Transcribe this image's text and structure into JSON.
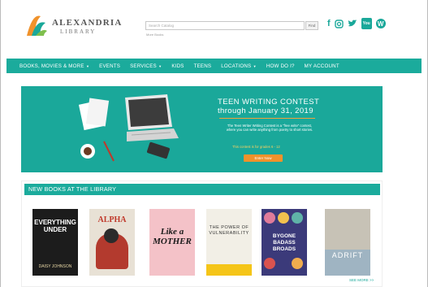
{
  "header": {
    "logo_name": "ALEXANDRIA",
    "logo_sub": "LIBRARY",
    "search_placeholder": "Search Catalog",
    "find_label": "Find",
    "sub_link": "More Books"
  },
  "nav": {
    "items": [
      {
        "label": "BOOKS, MOVIES & MORE",
        "dropdown": true
      },
      {
        "label": "EVENTS",
        "dropdown": false
      },
      {
        "label": "SERVICES",
        "dropdown": true
      },
      {
        "label": "KIDS",
        "dropdown": false
      },
      {
        "label": "TEENS",
        "dropdown": false
      },
      {
        "label": "LOCATIONS",
        "dropdown": true
      },
      {
        "label": "HOW DO I?",
        "dropdown": false
      },
      {
        "label": "MY ACCOUNT",
        "dropdown": false
      }
    ]
  },
  "hero": {
    "title_line1": "TEEN WRITING CONTEST",
    "title_line2": "through January 31, 2019",
    "description": "The Teen Writer Writing Contest is a \"free write\" contest, where you can write anything from poetry to short stories.",
    "grades": "This contest is for grades 6 - 12",
    "button": "Enter Now"
  },
  "books": {
    "heading": "NEW BOOKS AT THE LIBRARY",
    "see_more": "SEE MORE >>",
    "items": [
      {
        "title": "EVERYTHING UNDER",
        "author": "DAISY JOHNSON"
      },
      {
        "title": "ALPHA",
        "author": ""
      },
      {
        "title": "Like a MOTHER",
        "author": ""
      },
      {
        "title": "THE POWER OF VULNERABILITY",
        "author": ""
      },
      {
        "title": "BYGONE BADASS BROADS",
        "author": ""
      },
      {
        "title": "ADRIFT",
        "author": ""
      }
    ]
  },
  "colors": {
    "teal": "#1bab9c",
    "orange": "#f0922b",
    "gold": "#f7d060"
  }
}
